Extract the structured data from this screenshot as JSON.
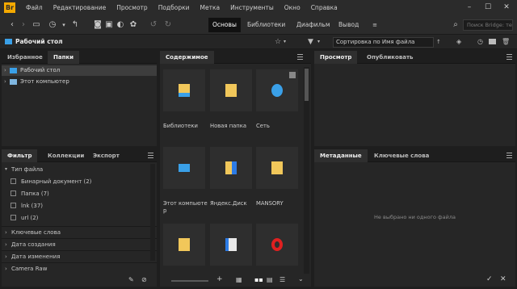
{
  "menubar": {
    "logo": "Br",
    "items": [
      "Файл",
      "Редактирование",
      "Просмотр",
      "Подборки",
      "Метка",
      "Инструменты",
      "Окно",
      "Справка"
    ]
  },
  "toolbar": {
    "workspaces": [
      "Основы",
      "Библиотеки",
      "Диафильм",
      "Вывод"
    ],
    "search_placeholder": "Поиск Bridge: текущ..."
  },
  "pathbar": {
    "path": "Рабочий стол",
    "sort_label": "Сортировка по Имя файла"
  },
  "left_top": {
    "tabs": [
      "Избранное",
      "Папки"
    ],
    "tree": [
      "Рабочий стол",
      "Этот компьютер"
    ]
  },
  "left_bottom": {
    "tabs": [
      "Фильтр",
      "Коллекции",
      "Экспорт"
    ],
    "section_file_type": "Тип файла",
    "file_types": [
      {
        "label": "Бинарный документ",
        "count": "(2)"
      },
      {
        "label": "Папка",
        "count": "(7)"
      },
      {
        "label": "lnk",
        "count": "(37)"
      },
      {
        "label": "url",
        "count": "(2)"
      }
    ],
    "sections": [
      "Ключевые слова",
      "Дата создания",
      "Дата изменения",
      "Camera Raw"
    ]
  },
  "content": {
    "tab": "Содержимое",
    "items": [
      "Библиотеки",
      "Новая папка",
      "Сеть",
      "Этот компьюте\nр",
      "Яндекс.Диск",
      "MANSORY",
      "",
      "",
      ""
    ]
  },
  "preview": {
    "tabs": [
      "Просмотр",
      "Опубликовать"
    ]
  },
  "metadata": {
    "tabs": [
      "Метаданные",
      "Ключевые слова"
    ],
    "empty_text": "Не выбрано ни одного файла"
  }
}
